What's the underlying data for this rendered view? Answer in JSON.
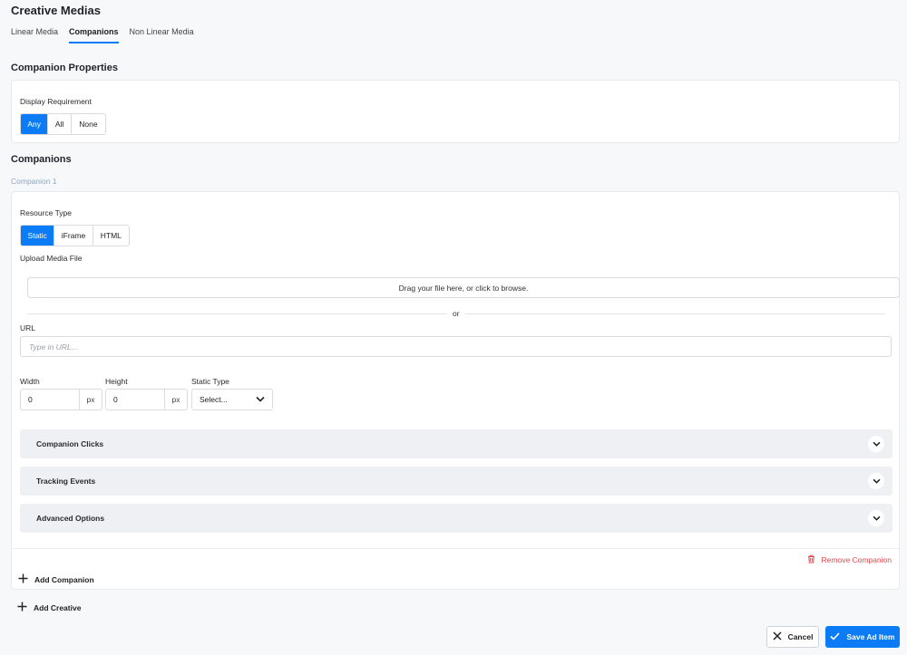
{
  "page": {
    "title": "Creative Medias"
  },
  "tabs": [
    {
      "label": "Linear Media",
      "active": false
    },
    {
      "label": "Companions",
      "active": true
    },
    {
      "label": "Non Linear Media",
      "active": false
    }
  ],
  "companion_properties": {
    "title": "Companion Properties",
    "display_requirement_label": "Display Requirement",
    "options": [
      "Any",
      "All",
      "None"
    ],
    "selected": "Any"
  },
  "companions": {
    "title": "Companions",
    "item_label": "Companion 1",
    "resource_type_label": "Resource Type",
    "resource_options": [
      "Static",
      "iFrame",
      "HTML"
    ],
    "resource_selected": "Static",
    "upload_label": "Upload Media File",
    "dropzone_text": "Drag your file here, or click to browse.",
    "or_text": "or",
    "url_label": "URL",
    "url_placeholder": "Type in URL...",
    "url_value": "",
    "width_label": "Width",
    "width_value": "0",
    "height_label": "Height",
    "height_value": "0",
    "unit": "px",
    "static_type_label": "Static Type",
    "static_type_value": "Select...",
    "accordions": [
      {
        "label": "Companion Clicks"
      },
      {
        "label": "Tracking Events"
      },
      {
        "label": "Advanced Options"
      }
    ],
    "remove_label": "Remove Companion",
    "add_companion_label": "Add Companion"
  },
  "add_creative_label": "Add Creative",
  "footer": {
    "cancel_label": "Cancel",
    "save_label": "Save Ad Item"
  },
  "colors": {
    "accent": "#0b7cf5",
    "danger": "#e5484d",
    "background": "#f7f8fa"
  }
}
